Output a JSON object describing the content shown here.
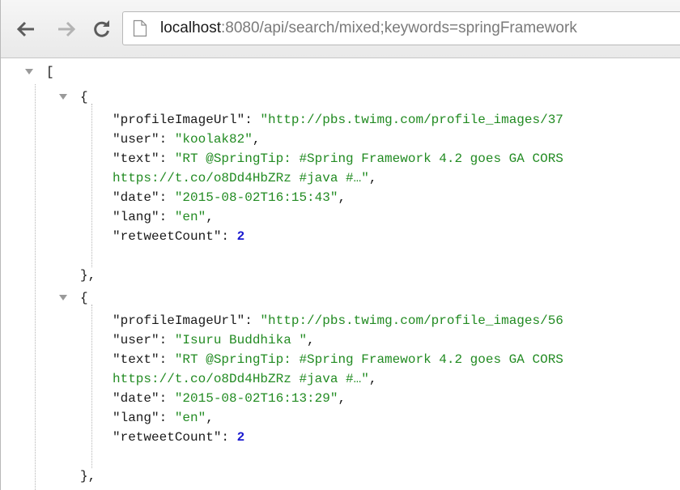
{
  "toolbar": {
    "back_icon": "back-arrow-icon",
    "forward_icon": "forward-arrow-icon",
    "reload_icon": "reload-icon",
    "page_icon": "page-icon"
  },
  "address_bar": {
    "host": "localhost",
    "path": ":8080/api/search/mixed;keywords=springFramework"
  },
  "json_view": {
    "open_bracket": "[",
    "items": [
      {
        "open_brace": "{",
        "profileImageUrl_key": "\"profileImageUrl\"",
        "profileImageUrl_value": "\"http://pbs.twimg.com/profile_images/37",
        "user_key": "\"user\"",
        "user_value": "\"koolak82\"",
        "text_key": "\"text\"",
        "text_value_line1": "\"RT @SpringTip: #Spring Framework 4.2 goes GA CORS",
        "text_value_line2": "https://t.co/o8Dd4HbZRz #java #…\"",
        "date_key": "\"date\"",
        "date_value": "\"2015-08-02T16:15:43\"",
        "lang_key": "\"lang\"",
        "lang_value": "\"en\"",
        "retweetCount_key": "\"retweetCount\"",
        "retweetCount_value": "2",
        "close_brace": "},"
      },
      {
        "open_brace": "{",
        "profileImageUrl_key": "\"profileImageUrl\"",
        "profileImageUrl_value": "\"http://pbs.twimg.com/profile_images/56",
        "user_key": "\"user\"",
        "user_value": "\"Isuru Buddhika \"",
        "text_key": "\"text\"",
        "text_value_line1": "\"RT @SpringTip: #Spring Framework 4.2 goes GA CORS",
        "text_value_line2": "https://t.co/o8Dd4HbZRz #java #…\"",
        "date_key": "\"date\"",
        "date_value": "\"2015-08-02T16:13:29\"",
        "lang_key": "\"lang\"",
        "lang_value": "\"en\"",
        "retweetCount_key": "\"retweetCount\"",
        "retweetCount_value": "2",
        "close_brace": "},"
      }
    ]
  },
  "colors": {
    "key": "#1a1a1a",
    "string": "#228b22",
    "number": "#1a1ad0",
    "url_host": "#1a1a1a",
    "url_path": "#7a7a7a"
  }
}
